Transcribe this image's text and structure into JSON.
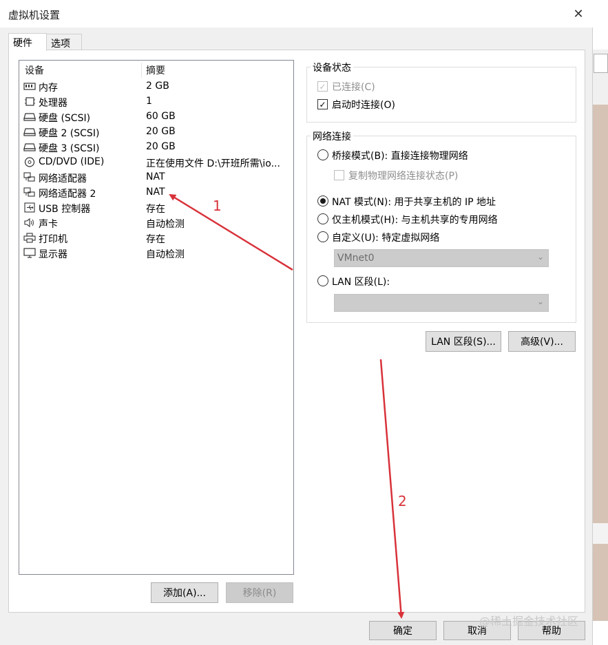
{
  "window": {
    "title": "虚拟机设置",
    "close_glyph": "✕"
  },
  "tabs": [
    {
      "label": "硬件"
    },
    {
      "label": "选项"
    }
  ],
  "device_list": {
    "headers": {
      "device": "设备",
      "summary": "摘要"
    },
    "rows": [
      {
        "icon": "memory-icon",
        "name": "内存",
        "summary": "2 GB"
      },
      {
        "icon": "cpu-icon",
        "name": "处理器",
        "summary": "1"
      },
      {
        "icon": "disk-icon",
        "name": "硬盘 (SCSI)",
        "summary": "60 GB"
      },
      {
        "icon": "disk-icon",
        "name": "硬盘 2 (SCSI)",
        "summary": "20 GB"
      },
      {
        "icon": "disk-icon",
        "name": "硬盘 3 (SCSI)",
        "summary": "20 GB"
      },
      {
        "icon": "cd-icon",
        "name": "CD/DVD (IDE)",
        "summary": "正在使用文件 D:\\开班所需\\io..."
      },
      {
        "icon": "network-adapter-icon",
        "name": "网络适配器",
        "summary": "NAT"
      },
      {
        "icon": "network-adapter-icon",
        "name": "网络适配器 2",
        "summary": "NAT"
      },
      {
        "icon": "usb-icon",
        "name": "USB 控制器",
        "summary": "存在"
      },
      {
        "icon": "speaker-icon",
        "name": "声卡",
        "summary": "自动检测"
      },
      {
        "icon": "printer-icon",
        "name": "打印机",
        "summary": "存在"
      },
      {
        "icon": "monitor-icon",
        "name": "显示器",
        "summary": "自动检测"
      }
    ]
  },
  "list_buttons": {
    "add": "添加(A)...",
    "remove": "移除(R)"
  },
  "device_status": {
    "title": "设备状态",
    "connected": {
      "label": "已连接(C)",
      "checked": true,
      "enabled": false
    },
    "connect_at_power_on": {
      "label": "启动时连接(O)",
      "checked": true,
      "enabled": true
    }
  },
  "network_connection": {
    "title": "网络连接",
    "bridged": {
      "label": "桥接模式(B): 直接连接物理网络",
      "selected": false
    },
    "replicate_state": {
      "label": "复制物理网络连接状态(P)",
      "checked": false,
      "enabled": false
    },
    "nat": {
      "label": "NAT 模式(N): 用于共享主机的 IP 地址",
      "selected": true
    },
    "host_only": {
      "label": "仅主机模式(H): 与主机共享的专用网络",
      "selected": false
    },
    "custom": {
      "label": "自定义(U): 特定虚拟网络",
      "selected": false,
      "value": "VMnet0"
    },
    "lan_segment": {
      "label": "LAN 区段(L):",
      "selected": false,
      "value": ""
    }
  },
  "network_buttons": {
    "lan_segments": "LAN 区段(S)...",
    "advanced": "高级(V)..."
  },
  "dialog_buttons": {
    "ok": "确定",
    "cancel": "取消",
    "help": "帮助"
  },
  "annotations": {
    "marker_1": "1",
    "marker_2": "2",
    "color": "#d8323a"
  },
  "watermark": "@稀土掘金技术社区"
}
